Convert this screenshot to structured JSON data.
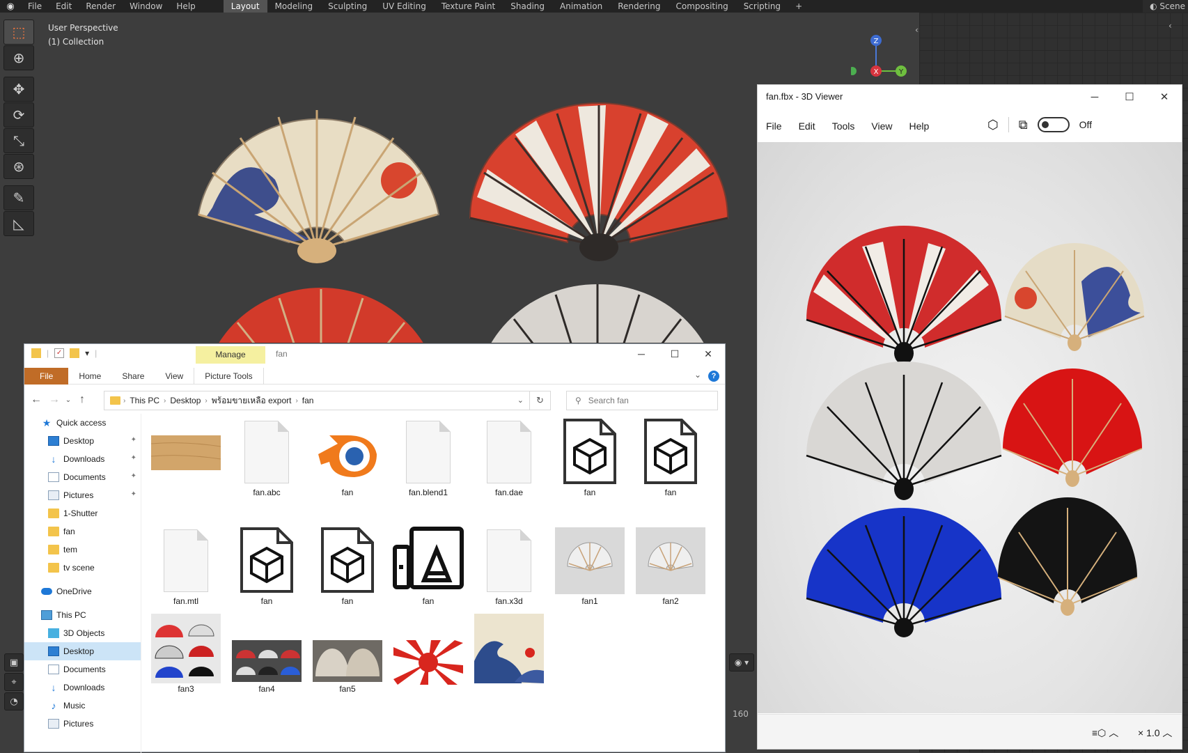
{
  "blender": {
    "menus": [
      "File",
      "Edit",
      "Render",
      "Window",
      "Help"
    ],
    "workspaces": [
      "Layout",
      "Modeling",
      "Sculpting",
      "UV Editing",
      "Texture Paint",
      "Shading",
      "Animation",
      "Rendering",
      "Compositing",
      "Scripting"
    ],
    "active_workspace": "Layout",
    "add_workspace": "+",
    "scene_label": "Scene",
    "viewport": {
      "perspective": "User Perspective",
      "collection": "(1) Collection",
      "frame": "160",
      "gizmo": {
        "z": "Z",
        "x": "X",
        "y": "Y"
      }
    }
  },
  "explorer": {
    "manage_tab": "Manage",
    "title": "fan",
    "ribbon": {
      "file": "File",
      "home": "Home",
      "share": "Share",
      "view": "View",
      "picture_tools": "Picture Tools",
      "help": "?"
    },
    "breadcrumb": [
      "This PC",
      "Desktop",
      "พร้อมขายเหลือ export",
      "fan"
    ],
    "search_placeholder": "Search fan",
    "sidebar": [
      {
        "label": "Quick access",
        "icon": "star-icon",
        "level": 0,
        "pinned": false
      },
      {
        "label": "Desktop",
        "icon": "desktop-icon",
        "level": 1,
        "pinned": true
      },
      {
        "label": "Downloads",
        "icon": "download-icon",
        "level": 1,
        "pinned": true
      },
      {
        "label": "Documents",
        "icon": "documents-icon",
        "level": 1,
        "pinned": true
      },
      {
        "label": "Pictures",
        "icon": "pictures-icon",
        "level": 1,
        "pinned": true
      },
      {
        "label": "1-Shutter",
        "icon": "folder-icon",
        "level": 1,
        "pinned": false
      },
      {
        "label": "fan",
        "icon": "folder-icon",
        "level": 1,
        "pinned": false
      },
      {
        "label": "tem",
        "icon": "folder-icon",
        "level": 1,
        "pinned": false
      },
      {
        "label": "tv scene",
        "icon": "folder-icon",
        "level": 1,
        "pinned": false
      },
      {
        "label": "OneDrive",
        "icon": "onedrive-icon",
        "level": 0,
        "pinned": false
      },
      {
        "label": "This PC",
        "icon": "this-pc-icon",
        "level": 0,
        "pinned": false
      },
      {
        "label": "3D Objects",
        "icon": "3d-objects-icon",
        "level": 1,
        "pinned": false
      },
      {
        "label": "Desktop",
        "icon": "desktop-icon",
        "level": 1,
        "pinned": false,
        "selected": true
      },
      {
        "label": "Documents",
        "icon": "documents-icon",
        "level": 1,
        "pinned": false
      },
      {
        "label": "Downloads",
        "icon": "download-icon",
        "level": 1,
        "pinned": false
      },
      {
        "label": "Music",
        "icon": "music-icon",
        "level": 1,
        "pinned": false
      },
      {
        "label": "Pictures",
        "icon": "pictures-icon",
        "level": 1,
        "pinned": false
      }
    ],
    "files": [
      {
        "label": "",
        "kind": "wood-texture"
      },
      {
        "label": "fan.abc",
        "kind": "blank"
      },
      {
        "label": "fan",
        "kind": "blender"
      },
      {
        "label": "fan.blend1",
        "kind": "blank"
      },
      {
        "label": "fan.dae",
        "kind": "blank"
      },
      {
        "label": "fan",
        "kind": "cube"
      },
      {
        "label": "fan",
        "kind": "cube"
      },
      {
        "label": "fan.mtl",
        "kind": "blank"
      },
      {
        "label": "fan",
        "kind": "cube"
      },
      {
        "label": "fan",
        "kind": "cube"
      },
      {
        "label": "fan",
        "kind": "print3d"
      },
      {
        "label": "fan.x3d",
        "kind": "blank"
      },
      {
        "label": "fan1",
        "kind": "photo-white-fan"
      },
      {
        "label": "fan2",
        "kind": "photo-white-fan"
      },
      {
        "label": "fan3",
        "kind": "photo-fan-grid"
      },
      {
        "label": "fan4",
        "kind": "photo-dark"
      },
      {
        "label": "fan5",
        "kind": "photo-fans"
      },
      {
        "label": "",
        "kind": "rising-sun"
      },
      {
        "label": "",
        "kind": "great-wave"
      }
    ]
  },
  "viewer": {
    "title": "fan.fbx - 3D Viewer",
    "menus": [
      "File",
      "Edit",
      "Tools",
      "View",
      "Help"
    ],
    "toggle_label": "Off",
    "zoom": "× 1.0"
  }
}
